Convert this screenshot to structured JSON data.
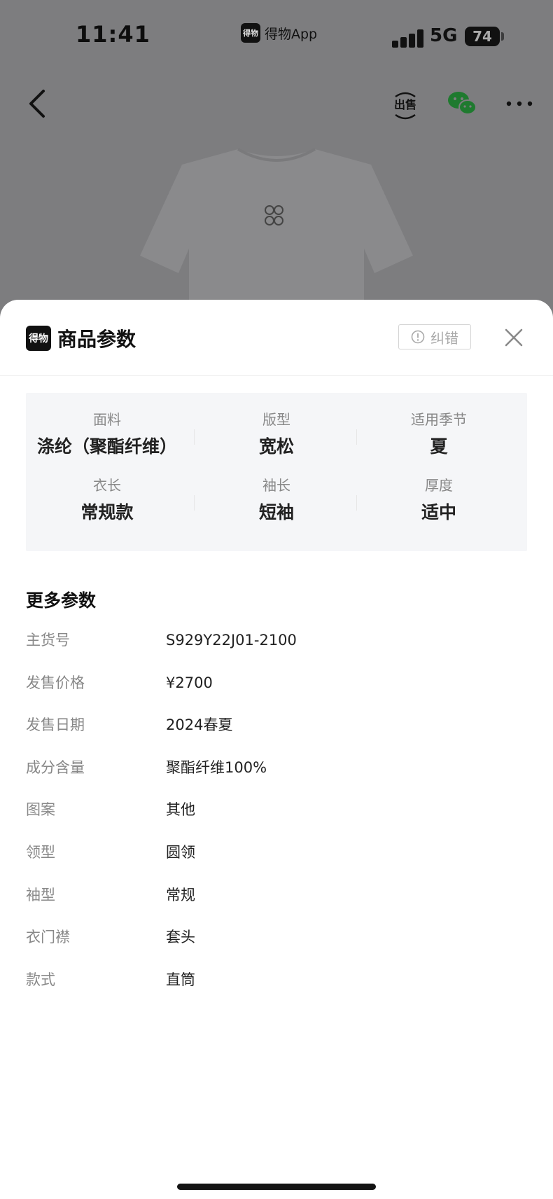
{
  "status_bar": {
    "time": "11:41",
    "app_name": "得物App",
    "app_badge": "得物",
    "network": "5G",
    "battery": "74"
  },
  "nav": {
    "sell_label": "出售"
  },
  "sheet": {
    "logo_text": "得物",
    "title": "商品参数",
    "report_label": "纠错"
  },
  "key_params": [
    {
      "label": "面料",
      "value": "涤纶（聚酯纤维）"
    },
    {
      "label": "版型",
      "value": "宽松"
    },
    {
      "label": "适用季节",
      "value": "夏"
    },
    {
      "label": "衣长",
      "value": "常规款"
    },
    {
      "label": "袖长",
      "value": "短袖"
    },
    {
      "label": "厚度",
      "value": "适中"
    }
  ],
  "more_params": {
    "title": "更多参数",
    "rows": [
      {
        "key": "主货号",
        "value": "S929Y22J01-2100"
      },
      {
        "key": "发售价格",
        "value": "¥2700"
      },
      {
        "key": "发售日期",
        "value": "2024春夏"
      },
      {
        "key": "成分含量",
        "value": "聚酯纤维100%"
      },
      {
        "key": "图案",
        "value": "其他"
      },
      {
        "key": "领型",
        "value": "圆领"
      },
      {
        "key": "袖型",
        "value": "常规"
      },
      {
        "key": "衣门襟",
        "value": "套头"
      },
      {
        "key": "款式",
        "value": "直筒"
      }
    ]
  },
  "colors": {
    "overlay": "#7d7d7f",
    "sheet": "#ffffff",
    "key_panel": "#f5f6f8",
    "wechat_green": "#1f7a2f"
  }
}
